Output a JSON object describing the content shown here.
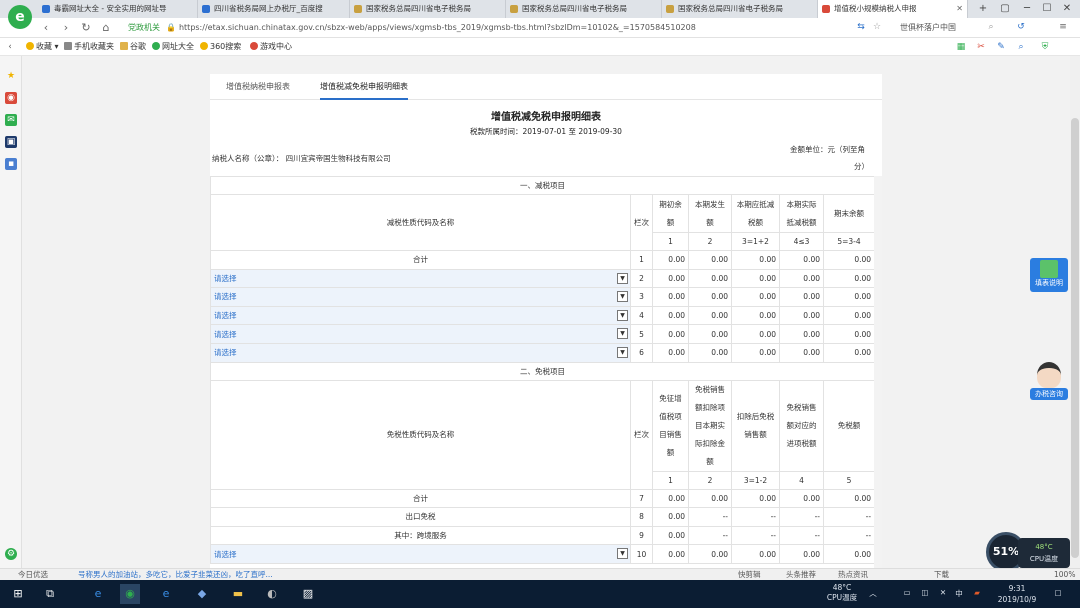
{
  "browser": {
    "tabs": [
      {
        "label": "毒霸网址大全 - 安全实用的网址导",
        "fav": "#2c6fd1"
      },
      {
        "label": "四川省税务局网上办税厅_百度搜",
        "fav": "#2c6fd1"
      },
      {
        "label": "国家税务总局四川省电子税务局",
        "fav": "#c8a040"
      },
      {
        "label": "国家税务总局四川省电子税务局",
        "fav": "#c8a040"
      },
      {
        "label": "国家税务总局四川省电子税务局",
        "fav": "#c8a040"
      },
      {
        "label": "增值税小规模纳税人申报",
        "fav": "#d94a3a"
      }
    ],
    "new_tab": "+",
    "logo": "e",
    "security_label": "党政机关",
    "url": "https://etax.sichuan.chinatax.gov.cn/sbzx-web/apps/views/xgmsb-tbs_2019/xgmsb-tbs.html?sbzlDm=10102&_=1570584510208",
    "search_text": "世俱杯落户中国",
    "bookmarks": [
      "收藏",
      "手机收藏夹",
      "谷歌",
      "网址大全",
      "360搜索",
      "游戏中心"
    ]
  },
  "form": {
    "tabs": [
      "增值税纳税申报表",
      "增值税减免税申报明细表"
    ],
    "title": "增值税减免税申报明细表",
    "period": "税款所属时间：2019-07-01 至 2019-09-30",
    "taxpayer": "纳税人名称（公章）： 四川宜宾帝国生物科技有限公司",
    "unit_line1": "金额单位：元（列至角",
    "unit_line2": "分）",
    "section1": "一、减税项目",
    "section1_code_header": "减税性质代码及名称",
    "line_header": "栏次",
    "section1_cols": [
      "期初余额",
      "本期发生额",
      "本期应抵减税额",
      "本期实际抵减税额",
      "期末余额"
    ],
    "section1_col_nums": [
      "1",
      "2",
      "3=1+2",
      "4≤3",
      "5=3-4"
    ],
    "total_label": "合计",
    "select_placeholder": "请选择",
    "section1_rows": [
      {
        "label": "合计",
        "line": "1",
        "vals": [
          "0.00",
          "0.00",
          "0.00",
          "0.00",
          "0.00"
        ],
        "select": false
      },
      {
        "label": "请选择",
        "line": "2",
        "vals": [
          "0.00",
          "0.00",
          "0.00",
          "0.00",
          "0.00"
        ],
        "select": true
      },
      {
        "label": "请选择",
        "line": "3",
        "vals": [
          "0.00",
          "0.00",
          "0.00",
          "0.00",
          "0.00"
        ],
        "select": true
      },
      {
        "label": "请选择",
        "line": "4",
        "vals": [
          "0.00",
          "0.00",
          "0.00",
          "0.00",
          "0.00"
        ],
        "select": true
      },
      {
        "label": "请选择",
        "line": "5",
        "vals": [
          "0.00",
          "0.00",
          "0.00",
          "0.00",
          "0.00"
        ],
        "select": true
      },
      {
        "label": "请选择",
        "line": "6",
        "vals": [
          "0.00",
          "0.00",
          "0.00",
          "0.00",
          "0.00"
        ],
        "select": true
      }
    ],
    "section2": "二、免税项目",
    "section2_code_header": "免税性质代码及名称",
    "section2_cols": [
      "免征增值税项目销售额",
      "免税销售额扣除项目本期实际扣除金额",
      "扣除后免税销售额",
      "免税销售额对应的进项税额",
      "免税额"
    ],
    "section2_col_nums": [
      "1",
      "2",
      "3=1-2",
      "4",
      "5"
    ],
    "section2_rows": [
      {
        "label": "合计",
        "line": "7",
        "vals": [
          "0.00",
          "0.00",
          "0.00",
          "0.00",
          "0.00"
        ],
        "select": false
      },
      {
        "label": "出口免税",
        "line": "8",
        "vals": [
          "0.00",
          "--",
          "--",
          "--",
          "--"
        ],
        "select": false
      },
      {
        "label": "其中：跨境服务",
        "line": "9",
        "vals": [
          "0.00",
          "--",
          "--",
          "--",
          "--"
        ],
        "select": false
      },
      {
        "label": "请选择",
        "line": "10",
        "vals": [
          "0.00",
          "0.00",
          "0.00",
          "0.00",
          "0.00"
        ],
        "select": true
      }
    ]
  },
  "floating": {
    "help": "填表说明",
    "consult": "办税咨询"
  },
  "status": {
    "left1": "今日优选",
    "left2": "号称男人的加油站，多吃它，比爱子韭菜还凶，吃了直呼...",
    "items": [
      "快剪辑",
      "头条推荐",
      "热点资讯",
      "下载"
    ],
    "zoom": "100%"
  },
  "monitor": {
    "cpu_percent": "51%",
    "temp": "48°C",
    "label": "CPU温度"
  },
  "taskbar": {
    "cpu_temp": "48°C",
    "cpu_label": "CPU温度",
    "ime": "中",
    "time": "9:31",
    "date": "2019/10/9"
  }
}
